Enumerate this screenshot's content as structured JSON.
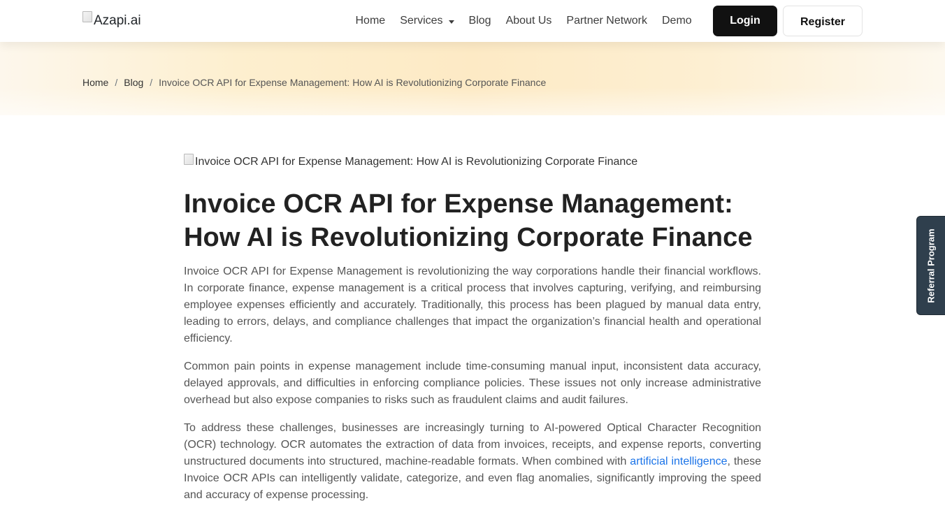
{
  "header": {
    "logo_alt": "Azapi.ai",
    "nav": [
      {
        "label": "Home"
      },
      {
        "label": "Services",
        "dropdown": true
      },
      {
        "label": "Blog"
      },
      {
        "label": "About Us"
      },
      {
        "label": "Partner Network"
      },
      {
        "label": "Demo"
      }
    ],
    "login_label": "Login",
    "register_label": "Register"
  },
  "breadcrumb": {
    "home": "Home",
    "blog": "Blog",
    "separator": "/",
    "current": "Invoice OCR API for Expense Management: How AI is Revolutionizing Corporate Finance"
  },
  "article": {
    "image_alt": "Invoice OCR API for Expense Management: How AI is Revolutionizing Corporate Finance",
    "title": "Invoice OCR API for Expense Management: How AI is Revolutionizing Corporate Finance",
    "p1": "Invoice OCR API for Expense Management is revolutionizing the way corporations handle their financial workflows. In corporate finance, expense management is a critical process that involves capturing, verifying, and reimbursing employee expenses efficiently and accurately. Traditionally, this process has been plagued by manual data entry, leading to errors, delays, and compliance challenges that impact the organization’s financial health and operational efficiency.",
    "p2": "Common pain points in expense management include time-consuming manual input, inconsistent data accuracy, delayed approvals, and difficulties in enforcing compliance policies. These issues not only increase administrative overhead but also expose companies to risks such as fraudulent claims and audit failures.",
    "p3_before": "To address these challenges, businesses are increasingly turning to AI-powered Optical Character Recognition (OCR) technology. OCR automates the extraction of data from invoices, receipts, and expense reports, converting unstructured documents into structured, machine-readable formats. When combined with ",
    "p3_link": "artificial intelligence",
    "p3_after": ", these Invoice OCR APIs can intelligently validate, categorize, and even flag anomalies, significantly improving the speed and accuracy of expense processing."
  },
  "referral_label": "Referral Program",
  "colors": {
    "login_bg": "#111111",
    "link": "#1a73e8",
    "referral_bg": "#2f3f4d",
    "band": "#fdeac5"
  }
}
